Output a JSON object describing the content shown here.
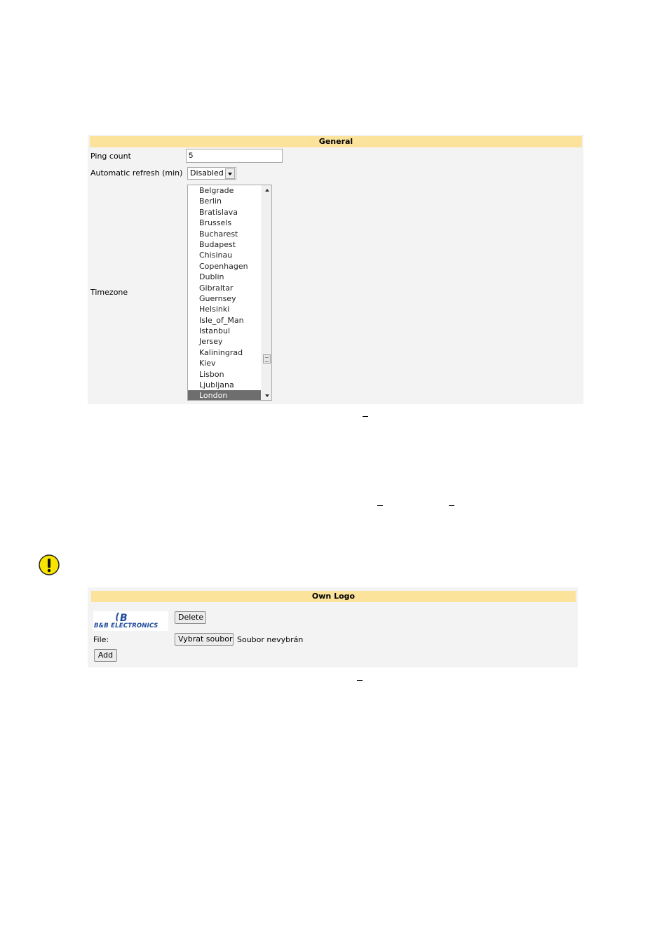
{
  "general": {
    "header": "General",
    "ping_count": {
      "label": "Ping count",
      "value": "5"
    },
    "refresh": {
      "label": "Automatic refresh (min)",
      "value": "Disabled"
    },
    "timezone": {
      "label": "Timezone",
      "options": [
        "Belgrade",
        "Berlin",
        "Bratislava",
        "Brussels",
        "Bucharest",
        "Budapest",
        "Chisinau",
        "Copenhagen",
        "Dublin",
        "Gibraltar",
        "Guernsey",
        "Helsinki",
        "Isle_of_Man",
        "Istanbul",
        "Jersey",
        "Kaliningrad",
        "Kiev",
        "Lisbon",
        "Ljubljana",
        "London"
      ],
      "selected": "London"
    }
  },
  "own_logo": {
    "header": "Own Logo",
    "logo_text": "B&B ELECTRONICS",
    "logo_mark": "B",
    "delete_label": "Delete",
    "file_label": "File:",
    "choose_label": "Vybrat soubor",
    "no_file_text": "Soubor nevybrán",
    "add_label": "Add"
  },
  "colors": {
    "header_bg": "#fbe39b",
    "panel_bg": "#f3f3f3",
    "selected_bg": "#6e6e6e",
    "warning": "#f7e400",
    "logo_blue": "#1f4a9c"
  }
}
